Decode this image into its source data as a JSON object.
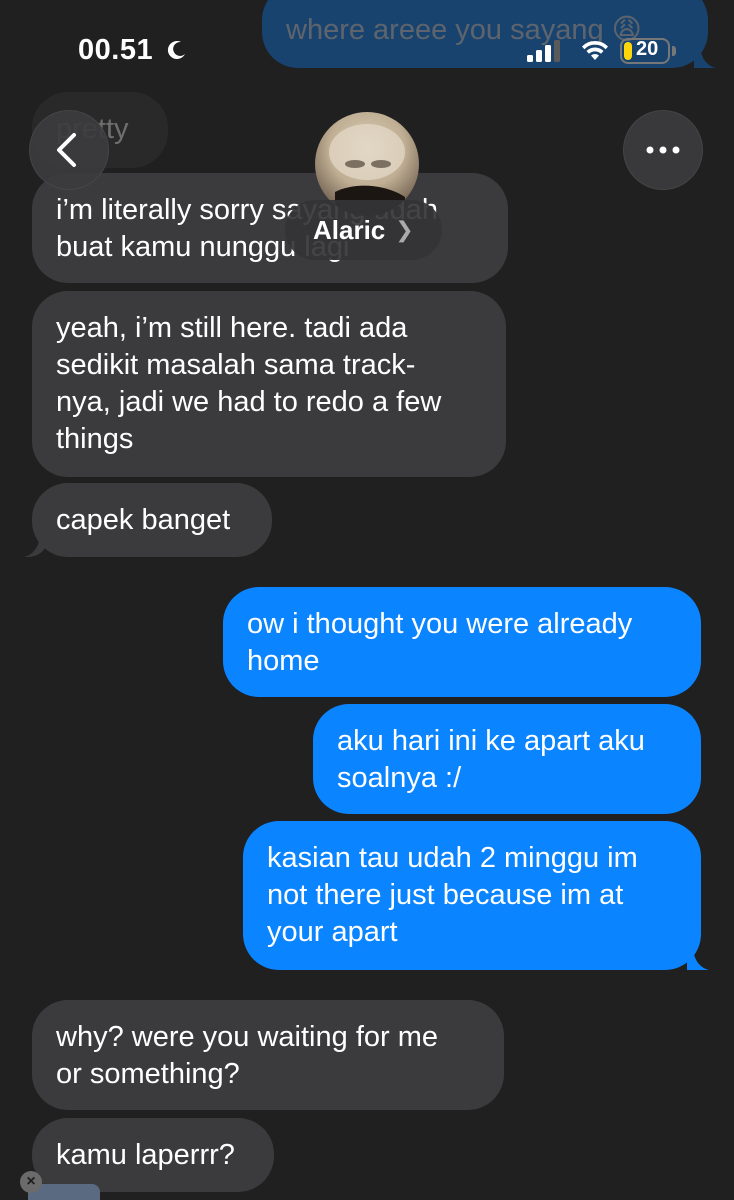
{
  "status_bar": {
    "time": "00.51",
    "battery_level": "20",
    "icons": [
      "moon-icon",
      "cellular-signal-icon",
      "wifi-icon",
      "battery-icon"
    ]
  },
  "header": {
    "contact_name": "Alaric",
    "back_icon": "chevron-left-icon",
    "more_icon": "ellipsis-icon"
  },
  "messages": [
    {
      "id": "m0",
      "side": "sent",
      "text": "where areee you sayang 😩"
    },
    {
      "id": "m1",
      "side": "recv",
      "text": "pretty"
    },
    {
      "id": "m2",
      "side": "recv",
      "text": "i’m literally sorry sayang udah\nbuat kamu nunggu lagi"
    },
    {
      "id": "m3",
      "side": "recv",
      "text": "yeah, i’m still here. tadi ada\nsedikit masalah sama track-\nnya, jadi we had to redo a few\nthings"
    },
    {
      "id": "m4",
      "side": "recv",
      "text": "capek banget"
    },
    {
      "id": "m5",
      "side": "sent",
      "text": "ow i thought you were already\nhome"
    },
    {
      "id": "m6",
      "side": "sent",
      "text": "aku hari ini ke apart aku\nsoalnya :/"
    },
    {
      "id": "m7",
      "side": "sent",
      "text": "kasian tau udah 2 minggu im\nnot there just because im at\nyour apart"
    },
    {
      "id": "m8",
      "side": "recv",
      "text": "why? were you waiting for me\nor something?"
    },
    {
      "id": "m9",
      "side": "recv",
      "text": "kamu laperrr?"
    }
  ],
  "colors": {
    "background": "#202020",
    "received_bubble": "#3b3b3d",
    "sent_bubble": "#0a84ff",
    "battery": "#ffd60a"
  }
}
